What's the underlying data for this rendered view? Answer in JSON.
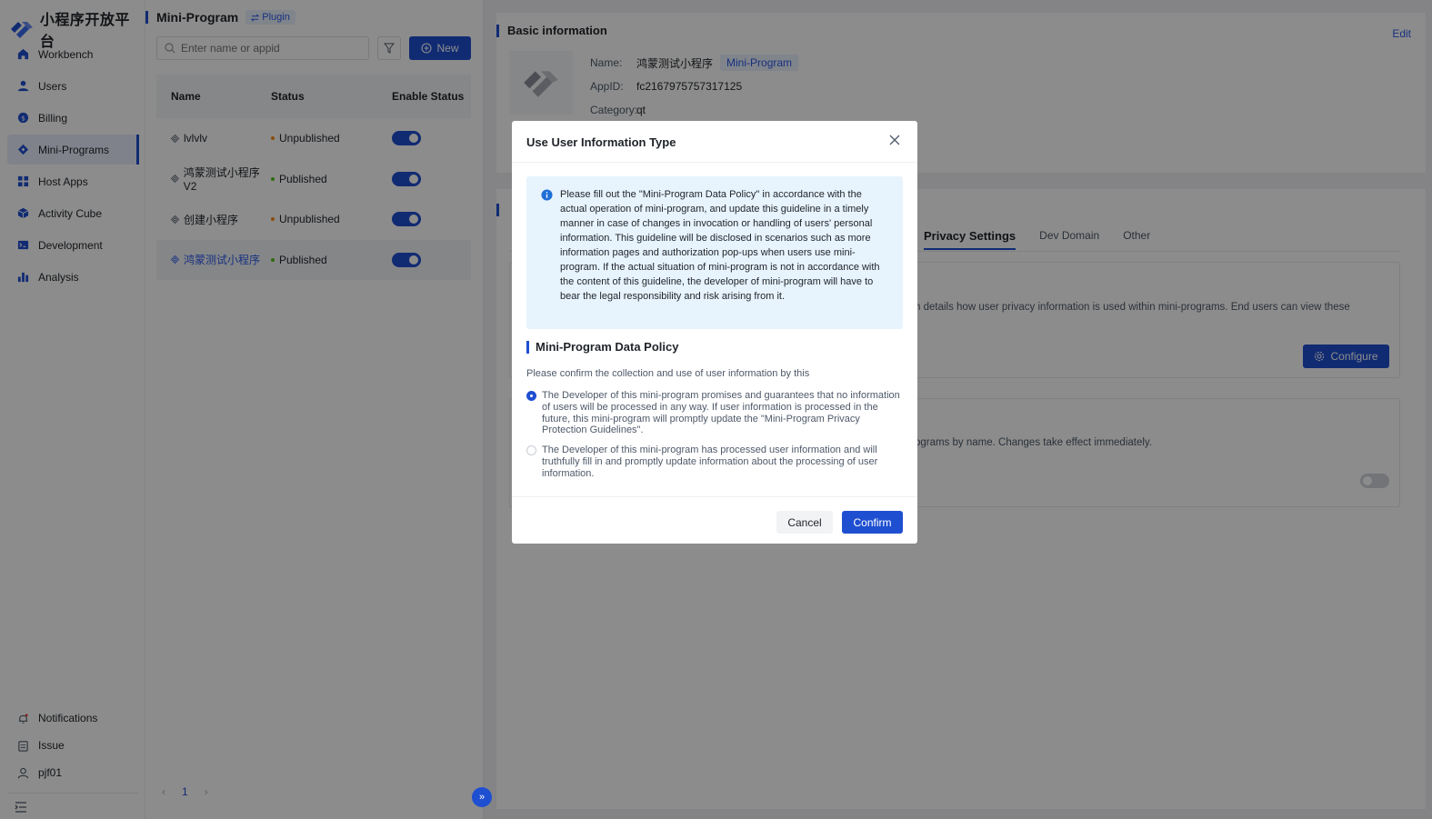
{
  "app": {
    "name": "小程序开放平台"
  },
  "sidebar": {
    "items": [
      {
        "label": "Workbench",
        "icon": "home-icon"
      },
      {
        "label": "Users",
        "icon": "user-icon"
      },
      {
        "label": "Billing",
        "icon": "coin-icon"
      },
      {
        "label": "Mini-Programs",
        "icon": "diamond-icon",
        "active": true
      },
      {
        "label": "Host Apps",
        "icon": "grid-icon"
      },
      {
        "label": "Activity Cube",
        "icon": "cube-icon"
      },
      {
        "label": "Development",
        "icon": "terminal-icon"
      },
      {
        "label": "Analysis",
        "icon": "bar-chart-icon"
      }
    ],
    "bottom": [
      {
        "label": "Notifications",
        "icon": "bell-icon"
      },
      {
        "label": "Issue",
        "icon": "clipboard-icon"
      },
      {
        "label": "pjf01",
        "icon": "person-icon"
      }
    ]
  },
  "list": {
    "title": "Mini-Program",
    "plugin_label": "Plugin",
    "search_placeholder": "Enter name or appid",
    "new_label": "New",
    "columns": {
      "name": "Name",
      "status": "Status",
      "enable": "Enable Status"
    },
    "rows": [
      {
        "name": "lvlvlv",
        "status": "Unpublished",
        "enabled": true
      },
      {
        "name": "鸿蒙测试小程序V2",
        "status": "Published",
        "enabled": true
      },
      {
        "name": "创建小程序",
        "status": "Unpublished",
        "enabled": true
      },
      {
        "name": "鸿蒙测试小程序",
        "status": "Published",
        "enabled": true,
        "selected": true
      }
    ],
    "page": "1"
  },
  "detail": {
    "basic_title": "Basic information",
    "edit_label": "Edit",
    "name_label": "Name:",
    "name_value": "鸿蒙测试小程序",
    "type_tag": "Mini-Program",
    "appid_label": "AppID:",
    "appid_value": "fc2167975757317125",
    "category_label": "Category:",
    "category_value": "qt",
    "tabs": [
      "Privacy Settings",
      "Dev Domain",
      "Other"
    ],
    "privacy_text": "n details how user privacy information is used within mini-programs. End users can view these",
    "configure_label": "Configure",
    "name_text": "ograms by name. Changes take effect immediately."
  },
  "modal": {
    "title": "Use User Information Type",
    "notice": "Please fill out the \"Mini-Program Data Policy\" in accordance with the actual operation of mini-program, and update this guideline in a timely manner in case of changes in invocation or handling of users' personal information. This guideline will be disclosed in scenarios such as more information pages and authorization pop-ups when users use mini-program. If the actual situation of mini-program is not in accordance with the content of this guideline, the developer of mini-program will have to bear the legal responsibility and risk arising from it.",
    "policy_title": "Mini-Program Data Policy",
    "policy_desc": "Please confirm the collection and use of user information by this",
    "options": [
      {
        "text": "The Developer of this mini-program promises and guarantees that no information of users will be processed in any way. If user information is processed in the future, this mini-program will promptly update the \"Mini-Program Privacy Protection Guidelines\".",
        "checked": true
      },
      {
        "text": "The Developer of this mini-program has processed user information and will truthfully fill in and promptly update information about the processing of user information.",
        "checked": false
      }
    ],
    "cancel_label": "Cancel",
    "confirm_label": "Confirm"
  },
  "colors": {
    "accent": "#1f4fd1",
    "published": "#52c41a",
    "unpublished": "#fa8c16"
  }
}
